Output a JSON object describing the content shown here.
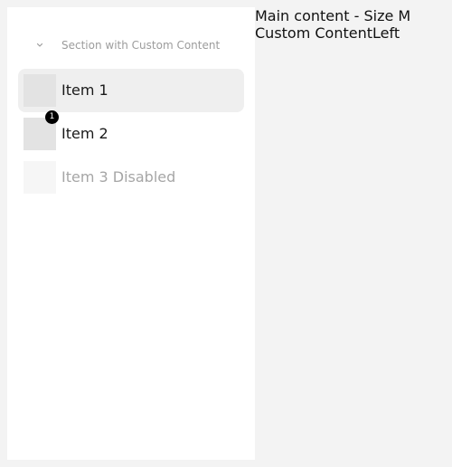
{
  "sidebar": {
    "section": {
      "title": "Section with Custom Content",
      "toggle_icon": "chevron-down-icon"
    },
    "items": [
      {
        "label": "Item 1",
        "state": "active",
        "badge": ""
      },
      {
        "label": "Item 2",
        "state": "default",
        "badge": "1"
      },
      {
        "label": "Item 3 Disabled",
        "state": "disabled",
        "badge": ""
      }
    ]
  },
  "main": {
    "line1": "Main content - Size M",
    "line2": "Custom ContentLeft"
  },
  "colors": {
    "page_background": "#f3f3f3",
    "sidebar_background": "#ffffff",
    "active_item_background": "#efefef",
    "badge_background": "#000000"
  }
}
